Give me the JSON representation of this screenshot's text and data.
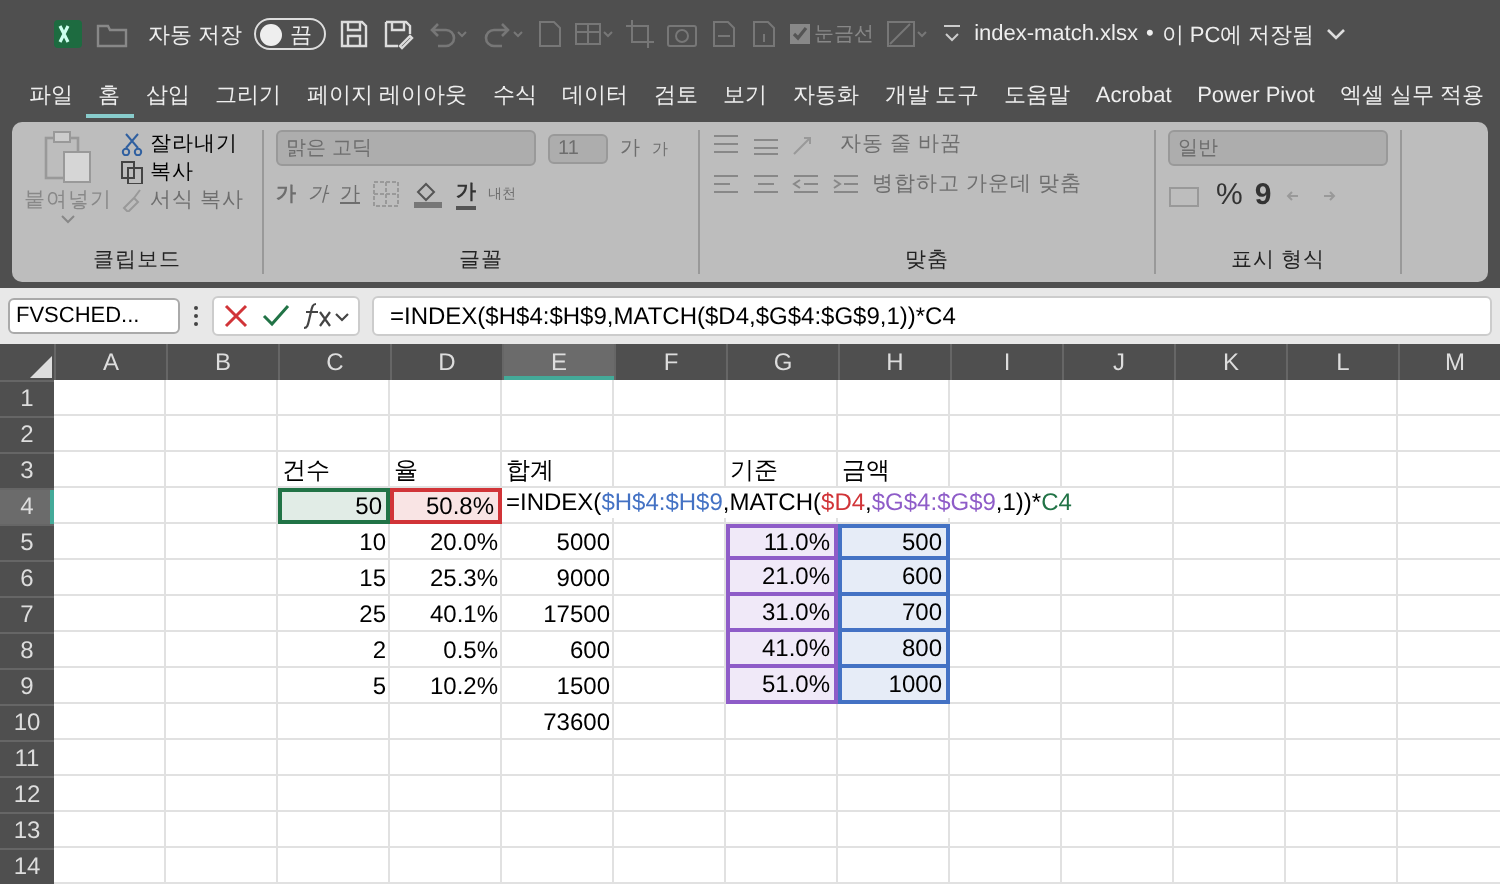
{
  "title_bar": {
    "autosave_label": "자동 저장",
    "autosave": {
      "on": false,
      "label": "끔"
    },
    "gridlines": {
      "label": "눈금선",
      "checked": true
    },
    "file_name": "index-match.xlsx",
    "separator": "•",
    "save_status": "이 PC에 저장됨"
  },
  "menu_tabs": [
    {
      "label": "파일",
      "selected": false
    },
    {
      "label": "홈",
      "selected": true
    },
    {
      "label": "삽입",
      "selected": false
    },
    {
      "label": "그리기",
      "selected": false
    },
    {
      "label": "페이지 레이아웃",
      "selected": false
    },
    {
      "label": "수식",
      "selected": false
    },
    {
      "label": "데이터",
      "selected": false
    },
    {
      "label": "검토",
      "selected": false
    },
    {
      "label": "보기",
      "selected": false
    },
    {
      "label": "자동화",
      "selected": false
    },
    {
      "label": "개발 도구",
      "selected": false
    },
    {
      "label": "도움말",
      "selected": false
    },
    {
      "label": "Acrobat",
      "selected": false
    },
    {
      "label": "Power Pivot",
      "selected": false
    },
    {
      "label": "엑셀 실무 적용",
      "selected": false
    }
  ],
  "ribbon": {
    "disabled": true,
    "clipboard": {
      "title": "클립보드",
      "paste": "붙여넣기",
      "cut": "잘라내기",
      "copy": "복사",
      "format_painter": "서식 복사"
    },
    "font": {
      "title": "글꼴",
      "font_name": "맑은 고딕",
      "font_size": "11",
      "grow": "가",
      "shrink": "가",
      "bold": "가",
      "italic": "가",
      "underline": "가",
      "font_color": "가",
      "phonetic": "내천"
    },
    "alignment": {
      "title": "맞춤",
      "wrap_text": "자동 줄 바꿈",
      "merge_center": "병합하고 가운데 맞춤"
    },
    "number": {
      "title": "표시 형식",
      "format": "일반",
      "percent": "%",
      "comma": "9"
    }
  },
  "formula_bar": {
    "name_box": "FVSCHED...",
    "formula": "=INDEX($H$4:$H$9,MATCH($D4,$G$4:$G$9,1))*C4"
  },
  "sheet": {
    "columns": [
      {
        "label": "A",
        "selected": false
      },
      {
        "label": "B",
        "selected": false
      },
      {
        "label": "C",
        "selected": false
      },
      {
        "label": "D",
        "selected": false
      },
      {
        "label": "E",
        "selected": true
      },
      {
        "label": "F",
        "selected": false
      },
      {
        "label": "G",
        "selected": false
      },
      {
        "label": "H",
        "selected": false
      },
      {
        "label": "I",
        "selected": false
      },
      {
        "label": "J",
        "selected": false
      },
      {
        "label": "K",
        "selected": false
      },
      {
        "label": "L",
        "selected": false
      },
      {
        "label": "M",
        "selected": false
      }
    ],
    "rows": [
      {
        "label": "1",
        "selected": false,
        "cells": []
      },
      {
        "label": "2",
        "selected": false,
        "cells": []
      },
      {
        "label": "3",
        "selected": false,
        "cells": [
          {
            "kind": "empty"
          },
          {
            "kind": "empty"
          },
          {
            "kind": "text",
            "text": "건수"
          },
          {
            "kind": "text",
            "text": "율"
          },
          {
            "kind": "text",
            "text": "합계"
          },
          {
            "kind": "empty"
          },
          {
            "kind": "text",
            "text": "기준"
          },
          {
            "kind": "text",
            "text": "금액"
          }
        ]
      },
      {
        "label": "4",
        "selected": true,
        "cells": [
          {
            "kind": "empty"
          },
          {
            "kind": "empty"
          },
          {
            "kind": "number",
            "text": "50",
            "color": "#217346"
          },
          {
            "kind": "number",
            "text": "50.8%",
            "color": "#d13438"
          },
          {
            "kind": "editing",
            "segments": [
              {
                "text": "=INDEX(",
                "color": "#000000"
              },
              {
                "text": "$H$4:$H$9",
                "color": "#4472c4"
              },
              {
                "text": ",MATCH(",
                "color": "#000000"
              },
              {
                "text": "$D4",
                "color": "#d13438"
              },
              {
                "text": ",",
                "color": "#000000"
              },
              {
                "text": "$G$4:$G$9",
                "color": "#8e5cc8"
              },
              {
                "text": ",1))*",
                "color": "#000000"
              },
              {
                "text": "C4",
                "color": "#217346"
              }
            ]
          }
        ]
      },
      {
        "label": "5",
        "selected": false,
        "cells": [
          {
            "kind": "empty"
          },
          {
            "kind": "empty"
          },
          {
            "kind": "number",
            "text": "10"
          },
          {
            "kind": "number",
            "text": "20.0%"
          },
          {
            "kind": "number",
            "text": "5000"
          },
          {
            "kind": "empty"
          },
          {
            "kind": "number",
            "text": "11.0%",
            "color": "#8e5cc8"
          },
          {
            "kind": "number",
            "text": "500",
            "color": "#4472c4"
          }
        ]
      },
      {
        "label": "6",
        "selected": false,
        "cells": [
          {
            "kind": "empty"
          },
          {
            "kind": "empty"
          },
          {
            "kind": "number",
            "text": "15"
          },
          {
            "kind": "number",
            "text": "25.3%"
          },
          {
            "kind": "number",
            "text": "9000"
          },
          {
            "kind": "empty"
          },
          {
            "kind": "number",
            "text": "21.0%",
            "color": "#8e5cc8"
          },
          {
            "kind": "number",
            "text": "600",
            "color": "#4472c4"
          }
        ]
      },
      {
        "label": "7",
        "selected": false,
        "cells": [
          {
            "kind": "empty"
          },
          {
            "kind": "empty"
          },
          {
            "kind": "number",
            "text": "25"
          },
          {
            "kind": "number",
            "text": "40.1%"
          },
          {
            "kind": "number",
            "text": "17500"
          },
          {
            "kind": "empty"
          },
          {
            "kind": "number",
            "text": "31.0%",
            "color": "#8e5cc8"
          },
          {
            "kind": "number",
            "text": "700",
            "color": "#4472c4"
          }
        ]
      },
      {
        "label": "8",
        "selected": false,
        "cells": [
          {
            "kind": "empty"
          },
          {
            "kind": "empty"
          },
          {
            "kind": "number",
            "text": "2"
          },
          {
            "kind": "number",
            "text": "0.5%"
          },
          {
            "kind": "number",
            "text": "600"
          },
          {
            "kind": "empty"
          },
          {
            "kind": "number",
            "text": "41.0%",
            "color": "#8e5cc8"
          },
          {
            "kind": "number",
            "text": "800",
            "color": "#4472c4"
          }
        ]
      },
      {
        "label": "9",
        "selected": false,
        "cells": [
          {
            "kind": "empty"
          },
          {
            "kind": "empty"
          },
          {
            "kind": "number",
            "text": "5"
          },
          {
            "kind": "number",
            "text": "10.2%"
          },
          {
            "kind": "number",
            "text": "1500"
          },
          {
            "kind": "empty"
          },
          {
            "kind": "number",
            "text": "51.0%",
            "color": "#8e5cc8"
          },
          {
            "kind": "number",
            "text": "1000",
            "color": "#4472c4"
          }
        ]
      },
      {
        "label": "10",
        "selected": false,
        "cells": [
          {
            "kind": "empty"
          },
          {
            "kind": "empty"
          },
          {
            "kind": "empty"
          },
          {
            "kind": "empty"
          },
          {
            "kind": "number",
            "text": "73600"
          }
        ]
      },
      {
        "label": "11",
        "selected": false,
        "cells": []
      },
      {
        "label": "12",
        "selected": false,
        "cells": []
      },
      {
        "label": "13",
        "selected": false,
        "cells": []
      },
      {
        "label": "14",
        "selected": false,
        "cells": []
      }
    ]
  }
}
